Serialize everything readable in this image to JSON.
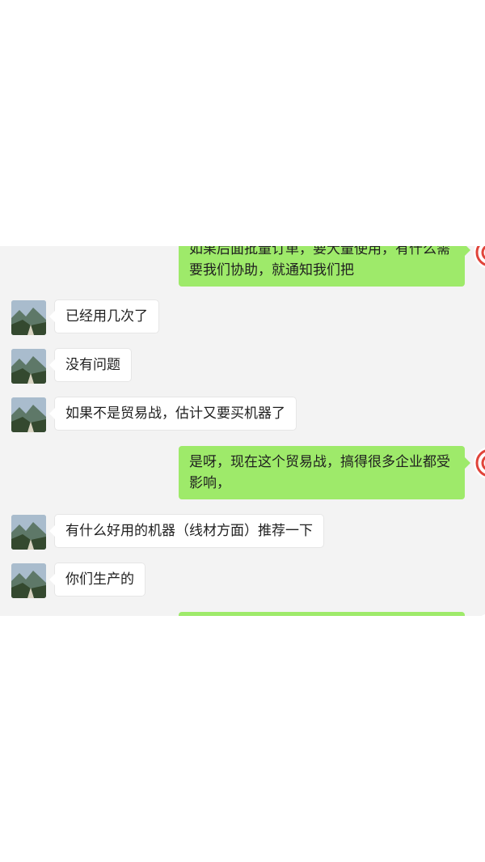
{
  "chat": {
    "messages": [
      {
        "side": "out",
        "text": "如果后面批量订单，要大量使用，有什么需要我们协助，就通知我们把"
      },
      {
        "side": "in",
        "text": "已经用几次了"
      },
      {
        "side": "in",
        "text": "没有问题"
      },
      {
        "side": "in",
        "text": "如果不是贸易战，估计又要买机器了"
      },
      {
        "side": "out",
        "text": "是呀，现在这个贸易战，搞得很多企业都受影响，"
      },
      {
        "side": "in",
        "text": "有什么好用的机器（线材方面）推荐一下"
      },
      {
        "side": "in",
        "text": "你们生产的"
      },
      {
        "side": "out",
        "text": ""
      }
    ]
  },
  "colors": {
    "chat_background": "#f3f3f3",
    "outgoing_bubble": "#9eea6a",
    "incoming_bubble": "#ffffff",
    "self_avatar_accent": "#e0443a"
  },
  "icons": {
    "contact_avatar": "landscape-avatar-icon",
    "self_avatar": "red-logo-avatar-icon"
  }
}
